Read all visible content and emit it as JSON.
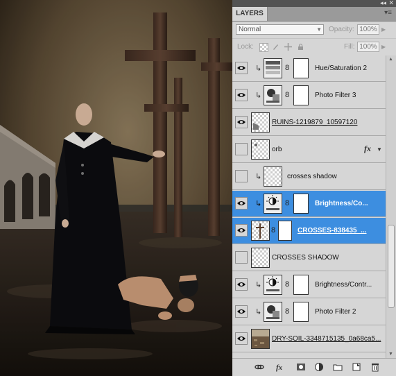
{
  "panel": {
    "title": "LAYERS",
    "blend_mode": "Normal",
    "opacity_label": "Opacity:",
    "opacity_value": "100%",
    "lock_label": "Lock:",
    "fill_label": "Fill:",
    "fill_value": "100%"
  },
  "layers": [
    {
      "name": "Hue/Saturation 2",
      "visible": true,
      "type": "adjustment",
      "clipped": true,
      "selected": false,
      "underline": false,
      "icon": "hue-saturation-icon"
    },
    {
      "name": "Photo Filter 3",
      "visible": true,
      "type": "adjustment",
      "clipped": true,
      "selected": false,
      "underline": false,
      "icon": "photo-filter-icon"
    },
    {
      "name": "RUINS-1219879_10597120",
      "visible": true,
      "type": "pixel",
      "clipped": false,
      "selected": false,
      "underline": true
    },
    {
      "name": "orb",
      "visible": false,
      "type": "pixel",
      "clipped": false,
      "selected": false,
      "underline": false,
      "fx": "fx"
    },
    {
      "name": "crosses shadow",
      "visible": false,
      "type": "pixel",
      "clipped": true,
      "selected": false,
      "underline": false
    },
    {
      "name": "Brightness/Co...",
      "visible": true,
      "type": "adjustment",
      "clipped": true,
      "selected": true,
      "underline": false,
      "icon": "brightness-contrast-icon"
    },
    {
      "name": "CROSSES-838435_...",
      "visible": true,
      "type": "masked",
      "clipped": false,
      "selected": true,
      "underline": true
    },
    {
      "name": "CROSSES SHADOW",
      "visible": false,
      "type": "pixel",
      "clipped": false,
      "selected": false,
      "underline": false
    },
    {
      "name": "Brightness/Contr...",
      "visible": true,
      "type": "adjustment",
      "clipped": true,
      "selected": false,
      "underline": false,
      "icon": "brightness-contrast-icon"
    },
    {
      "name": "Photo Filter 2",
      "visible": true,
      "type": "adjustment",
      "clipped": true,
      "selected": false,
      "underline": false,
      "icon": "photo-filter-icon"
    },
    {
      "name": "DRY-SOIL-3348715135_0a68ca5...",
      "visible": true,
      "type": "pixel",
      "clipped": false,
      "selected": false,
      "underline": true
    }
  ],
  "colors": {
    "selection": "#3d8ee0",
    "panel_bg": "#d6d6d6"
  },
  "toolbar_icons": [
    "link-layers-icon",
    "add-layer-style-icon",
    "add-mask-icon",
    "new-adjustment-layer-icon",
    "new-group-icon",
    "new-layer-icon",
    "delete-layer-icon"
  ]
}
